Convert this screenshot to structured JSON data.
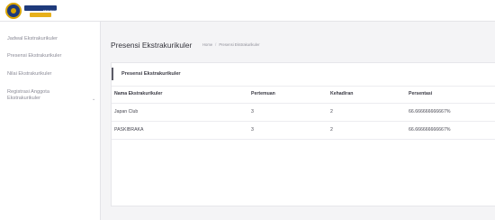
{
  "header": {
    "logo_text": "SMA NEGERI 1 KARANGANYAR"
  },
  "sidebar": {
    "items": [
      {
        "label": "Jadwal Ekstrakurikuler"
      },
      {
        "label": "Presensi Ekstrakurikuler"
      },
      {
        "label": "Nilai Ekstrakurikuler"
      },
      {
        "label": "Registrasi Anggota",
        "label2": "Ekstrakurikuler",
        "chevron": "chevron-down-icon"
      }
    ]
  },
  "main": {
    "title": "Presensi Ekstrakurikuler",
    "breadcrumb": {
      "home": "Home",
      "separator": "/",
      "current": "Presensi Ekstrakurikuler"
    },
    "card_title": "Presensi Ekstrakurikuler",
    "table": {
      "headers": [
        "Nama Ekstrakurikuler",
        "Pertemuan",
        "Kehadiran",
        "Persentasi"
      ],
      "rows": [
        [
          "Japan Club",
          "3",
          "2",
          "66.666666666667%"
        ],
        [
          "PASKIBRAKA",
          "3",
          "2",
          "66.666666666667%"
        ]
      ]
    }
  }
}
